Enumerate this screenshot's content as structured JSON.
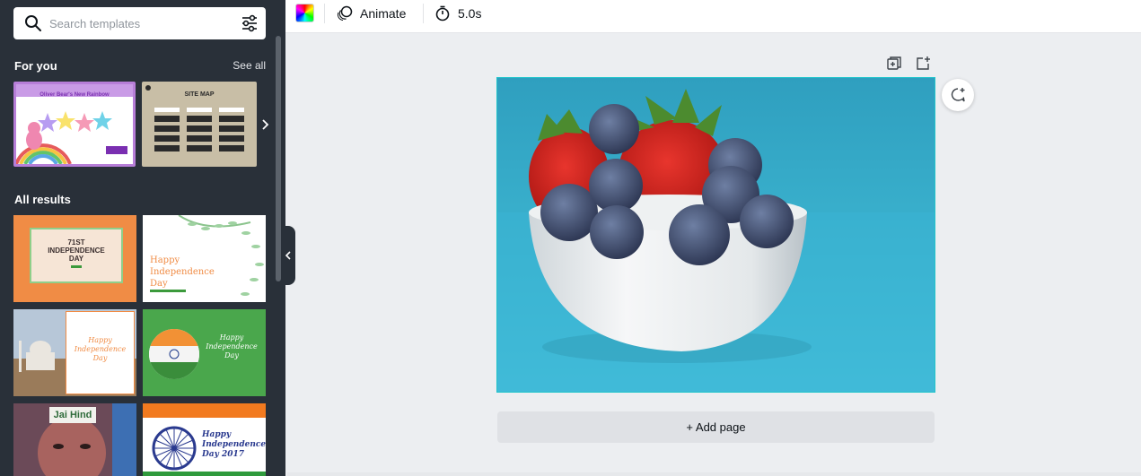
{
  "sidebar": {
    "search": {
      "placeholder": "Search templates"
    },
    "for_you": {
      "title": "For you",
      "see_all": "See all",
      "cards": [
        {
          "title": "Oliver Bear's New Rainbow"
        },
        {
          "title": "SITE MAP"
        }
      ]
    },
    "all_results": {
      "title": "All results",
      "cards": [
        {
          "lines": [
            "71ST",
            "INDEPENDENCE",
            "DAY"
          ]
        },
        {
          "lines": [
            "Happy",
            "Independence",
            "Day"
          ]
        },
        {
          "lines": [
            "Happy",
            "Independence",
            "Day"
          ]
        },
        {
          "lines": [
            "Happy",
            "Independence",
            "Day"
          ]
        },
        {
          "lines": [
            "Jai Hind"
          ]
        },
        {
          "lines": [
            "Happy",
            "Independence",
            "Day 2017"
          ]
        }
      ]
    }
  },
  "toolbar": {
    "animate_label": "Animate",
    "duration_label": "5.0s"
  },
  "canvas": {
    "add_page_label": "+ Add page",
    "colors": {
      "selection": "#20c4cb",
      "background": "#3bb3cf"
    }
  }
}
